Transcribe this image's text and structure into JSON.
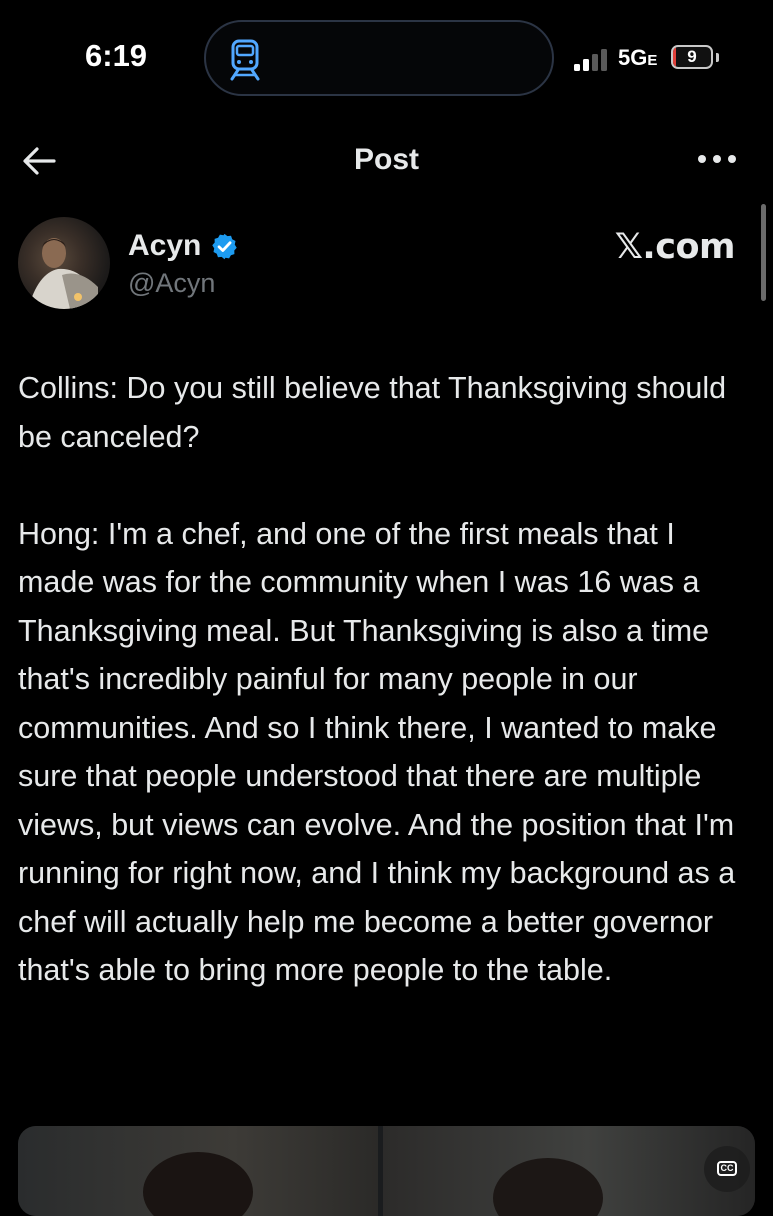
{
  "status_bar": {
    "time": "6:19",
    "network": "5G",
    "network_suffix": "E",
    "battery_percent": 9,
    "battery_label": "9",
    "signal_bars_active": 2,
    "signal_bars_total": 4
  },
  "nav": {
    "title": "Post"
  },
  "author": {
    "name": "Acyn",
    "handle": "@Acyn",
    "verified": true,
    "source": "𝕏.com"
  },
  "post": {
    "paragraphs": [
      "Collins: Do you still believe that Thanksgiving should be canceled?",
      "Hong: I'm a chef, and one of the first meals that I made was for the community when I was 16 was a Thanksgiving meal. But Thanksgiving is also a time that's incredibly painful for many people in our communities. And so I think there, I wanted to make sure that people understood that there are multiple views, but views can evolve. And the position that I'm running for right now, and I think my background as a chef will actually help me become a better governor that's able to bring more people to the table."
    ]
  },
  "media": {
    "cc_label": "CC"
  },
  "colors": {
    "background": "#000000",
    "text": "#e7e9ea",
    "secondary_text": "#71767b",
    "verified_blue": "#1d9bf0",
    "battery_low": "#e0403a"
  },
  "icons": [
    "tram-icon",
    "signal-icon",
    "battery-icon",
    "back-arrow-icon",
    "more-icon",
    "verified-icon",
    "cc-icon"
  ]
}
